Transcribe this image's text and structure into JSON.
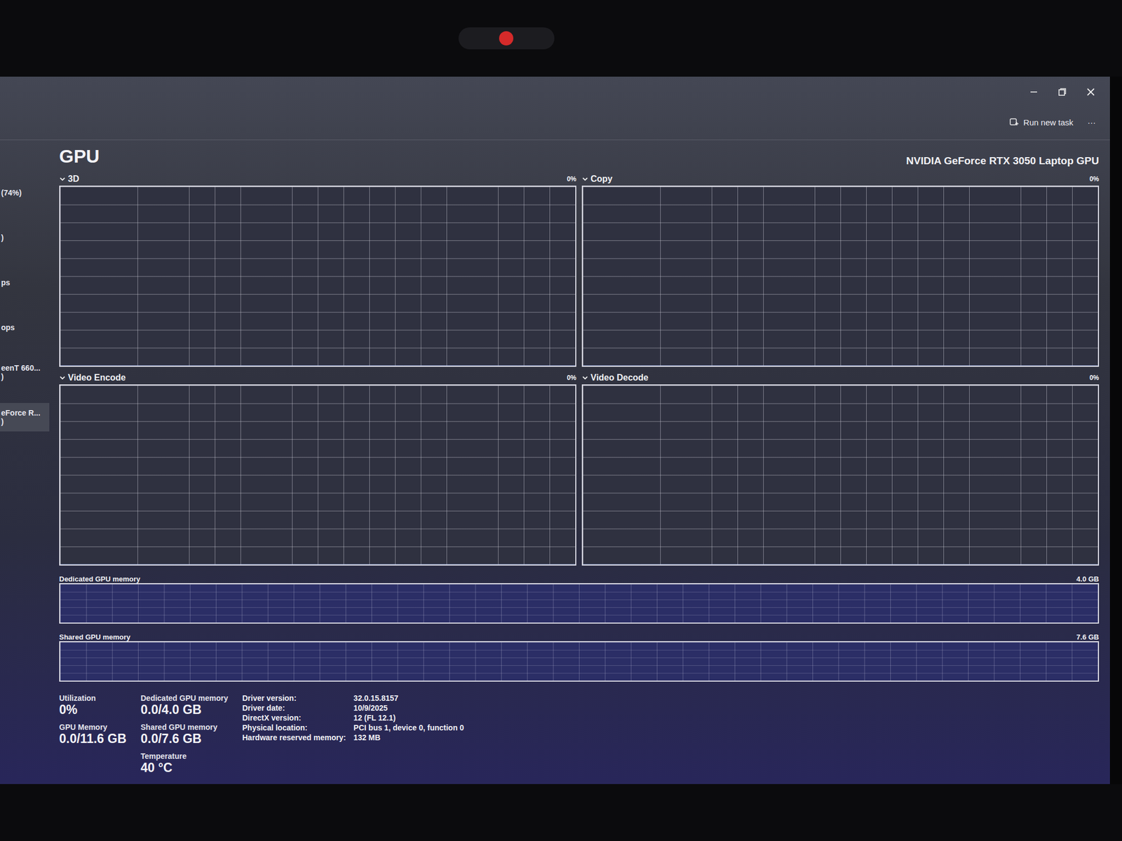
{
  "command_bar": {
    "run_new_task": "Run new task",
    "more": "···"
  },
  "sidebar": {
    "items": [
      {
        "lines": [
          "(74%)"
        ],
        "selected": false
      },
      {
        "lines": [
          ")"
        ],
        "selected": false
      },
      {
        "lines": [
          "ps"
        ],
        "selected": false
      },
      {
        "lines": [
          "ops"
        ],
        "selected": false
      },
      {
        "lines": [
          "eenT 660...",
          ")"
        ],
        "selected": false
      },
      {
        "lines": [
          "eForce R...",
          ")"
        ],
        "selected": true
      }
    ]
  },
  "page": {
    "title": "GPU",
    "device": "NVIDIA GeForce RTX 3050 Laptop GPU"
  },
  "graphs": [
    {
      "label": "3D",
      "reading": "0%",
      "values": [
        0,
        0,
        0,
        0,
        0,
        0,
        0,
        0,
        0,
        0
      ]
    },
    {
      "label": "Copy",
      "reading": "0%",
      "values": [
        0,
        0,
        0,
        0,
        0,
        0,
        0,
        0,
        0,
        0
      ]
    },
    {
      "label": "Video Encode",
      "reading": "0%",
      "values": [
        0,
        0,
        0,
        0,
        0,
        0,
        0,
        0,
        0,
        0
      ]
    },
    {
      "label": "Video Decode",
      "reading": "0%",
      "values": [
        0,
        0,
        0,
        0,
        0,
        0,
        0,
        0,
        0,
        0
      ]
    }
  ],
  "memory_bars": [
    {
      "label": "Dedicated GPU memory",
      "max": "4.0 GB",
      "level": 0
    },
    {
      "label": "Shared GPU memory",
      "max": "7.6 GB",
      "level": 0
    }
  ],
  "stats": {
    "columns": [
      [
        {
          "label": "Utilization",
          "value": "0%"
        },
        {
          "label": "GPU Memory",
          "value": "0.0/11.6 GB"
        }
      ],
      [
        {
          "label": "Dedicated GPU memory",
          "value": "0.0/4.0 GB"
        },
        {
          "label": "Shared GPU memory",
          "value": "0.0/7.6 GB"
        },
        {
          "label": "Temperature",
          "value": "40 °C"
        }
      ]
    ]
  },
  "details": [
    {
      "label": "Driver version:",
      "value": "32.0.15.8157"
    },
    {
      "label": "Driver date:",
      "value": "10/9/2025"
    },
    {
      "label": "DirectX version:",
      "value": "12 (FL 12.1)"
    },
    {
      "label": "Physical location:",
      "value": "PCI bus 1, device 0, function 0"
    },
    {
      "label": "Hardware reserved memory:",
      "value": "132 MB"
    }
  ]
}
